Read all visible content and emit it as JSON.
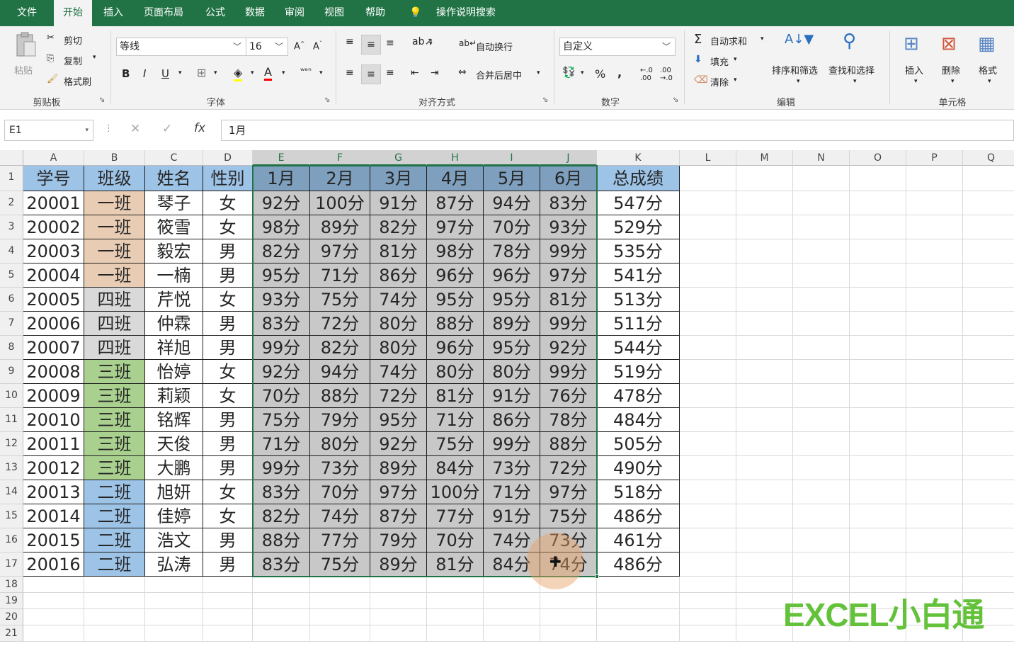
{
  "tabs": [
    "文件",
    "开始",
    "插入",
    "页面布局",
    "公式",
    "数据",
    "审阅",
    "视图",
    "帮助"
  ],
  "active_tab": "开始",
  "tell_me": "操作说明搜索",
  "ribbon": {
    "clipboard": {
      "paste": "粘贴",
      "cut": "剪切",
      "copy": "复制",
      "format_painter": "格式刷",
      "label": "剪贴板"
    },
    "font": {
      "name": "等线",
      "size": "16",
      "bold": "B",
      "italic": "I",
      "underline": "U",
      "label": "字体"
    },
    "alignment": {
      "wrap": "自动换行",
      "merge": "合并后居中",
      "label": "对齐方式"
    },
    "number": {
      "format": "自定义",
      "percent": "%",
      "comma": ",",
      "label": "数字"
    },
    "editing": {
      "autosum": "自动求和",
      "fill": "填充",
      "clear": "清除",
      "sort": "排序和筛选",
      "find": "查找和选择",
      "label": "编辑"
    },
    "cells": {
      "insert": "插入",
      "delete": "删除",
      "format": "格式",
      "label": "单元格"
    }
  },
  "name_box": "E1",
  "formula": "1月",
  "columns": [
    "A",
    "B",
    "C",
    "D",
    "E",
    "F",
    "G",
    "H",
    "I",
    "J",
    "K",
    "L",
    "M",
    "N",
    "O",
    "P",
    "Q"
  ],
  "row_numbers": [
    "1",
    "2",
    "3",
    "4",
    "5",
    "6",
    "7",
    "8",
    "9",
    "10",
    "11",
    "12",
    "13",
    "14",
    "15",
    "16",
    "17",
    "18",
    "19",
    "20",
    "21"
  ],
  "header": [
    "学号",
    "班级",
    "姓名",
    "性别",
    "1月",
    "2月",
    "3月",
    "4月",
    "5月",
    "6月",
    "总成绩"
  ],
  "rows": [
    [
      "20001",
      "一班",
      "琴子",
      "女",
      "92分",
      "100分",
      "91分",
      "87分",
      "94分",
      "83分",
      "547分"
    ],
    [
      "20002",
      "一班",
      "筱雪",
      "女",
      "98分",
      "89分",
      "82分",
      "97分",
      "70分",
      "93分",
      "529分"
    ],
    [
      "20003",
      "一班",
      "毅宏",
      "男",
      "82分",
      "97分",
      "81分",
      "98分",
      "78分",
      "99分",
      "535分"
    ],
    [
      "20004",
      "一班",
      "一楠",
      "男",
      "95分",
      "71分",
      "86分",
      "96分",
      "96分",
      "97分",
      "541分"
    ],
    [
      "20005",
      "四班",
      "芹悦",
      "女",
      "93分",
      "75分",
      "74分",
      "95分",
      "95分",
      "81分",
      "513分"
    ],
    [
      "20006",
      "四班",
      "仲霖",
      "男",
      "83分",
      "72分",
      "80分",
      "88分",
      "89分",
      "99分",
      "511分"
    ],
    [
      "20007",
      "四班",
      "祥旭",
      "男",
      "99分",
      "82分",
      "80分",
      "96分",
      "95分",
      "92分",
      "544分"
    ],
    [
      "20008",
      "三班",
      "怡婷",
      "女",
      "92分",
      "94分",
      "74分",
      "80分",
      "80分",
      "99分",
      "519分"
    ],
    [
      "20009",
      "三班",
      "莉颖",
      "女",
      "70分",
      "88分",
      "72分",
      "81分",
      "91分",
      "76分",
      "478分"
    ],
    [
      "20010",
      "三班",
      "铭辉",
      "男",
      "75分",
      "79分",
      "95分",
      "71分",
      "86分",
      "78分",
      "484分"
    ],
    [
      "20011",
      "三班",
      "天俊",
      "男",
      "71分",
      "80分",
      "92分",
      "75分",
      "99分",
      "88分",
      "505分"
    ],
    [
      "20012",
      "三班",
      "大鹏",
      "男",
      "99分",
      "73分",
      "89分",
      "84分",
      "73分",
      "72分",
      "490分"
    ],
    [
      "20013",
      "二班",
      "旭妍",
      "女",
      "83分",
      "70分",
      "97分",
      "100分",
      "71分",
      "97分",
      "518分"
    ],
    [
      "20014",
      "二班",
      "佳婷",
      "女",
      "82分",
      "74分",
      "87分",
      "77分",
      "91分",
      "75分",
      "486分"
    ],
    [
      "20015",
      "二班",
      "浩文",
      "男",
      "88分",
      "77分",
      "79分",
      "70分",
      "74分",
      "73分",
      "461分"
    ],
    [
      "20016",
      "二班",
      "弘涛",
      "男",
      "83分",
      "75分",
      "89分",
      "81分",
      "84分",
      "74分",
      "486分"
    ]
  ],
  "colors": {
    "accent": "#217346",
    "header_fill": "#9dc3e6",
    "selected_header_fill": "#7e9fbd",
    "selection_fill": "#c8c8c8",
    "class1": "#e8cdb4",
    "class4": "#d9d9d9",
    "class3": "#a9d08e",
    "class2": "#9dc3e6"
  },
  "watermark": "EXCEL小白通"
}
